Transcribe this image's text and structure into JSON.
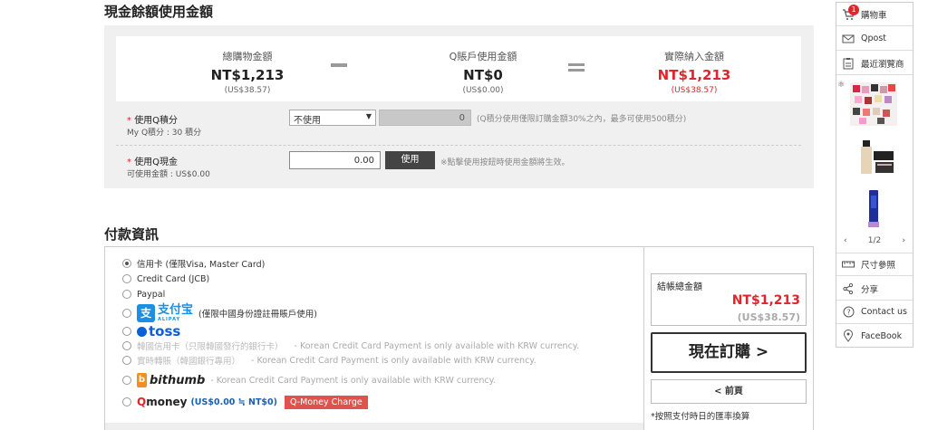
{
  "cash_section": {
    "title": "現金餘額使用金額",
    "total_label": "總購物金額",
    "total_value": "NT$1,213",
    "total_usd": "(US$38.57)",
    "q_label": "Q賬戶使用金額",
    "q_value": "NT$0",
    "q_usd": "(US$0.00)",
    "actual_label": "實際納入金額",
    "actual_value": "NT$1,213",
    "actual_usd": "(US$38.57)",
    "qpoint_label": "使用Q積分",
    "qpoint_sub": "My Q積分 : 30 積分",
    "qpoint_select": "不使用",
    "qpoint_input": "0",
    "qpoint_note": "(Q積分使用僅限訂購金額30%之內，最多可使用500積分)",
    "qcash_label": "使用Q現金",
    "qcash_sub": "可使用金額 : US$0.00",
    "qcash_input": "0.00",
    "qcash_button": "使用",
    "qcash_note": "※點擊使用按鈕時使用金額將生效。",
    "required_mark": "*"
  },
  "payment": {
    "title": "付款資訊",
    "options": [
      {
        "label": "信用卡 (僅限Visa, Master Card)",
        "selected": true
      },
      {
        "label": "Credit Card (JCB)"
      },
      {
        "label": "Paypal"
      },
      {
        "label": "(僅限中國身份證註冊賬戶使用)",
        "logo_text": "支付宝",
        "logo_sub": "ALIPAY",
        "logo_glyph": "支"
      },
      {
        "logo_text": "toss"
      },
      {
        "label": "韓國信用卡（只限韓國發行的銀行卡）",
        "note": "- Korean Credit Card Payment is only available with KRW currency."
      },
      {
        "label": "實時轉賬（韓國銀行專用）",
        "note": "- Korean Credit Card Payment is only available with KRW currency."
      },
      {
        "logo_text": "bithumb",
        "logo_glyph": "b",
        "note": "- Korean Credit Card Payment is only available with KRW currency."
      },
      {
        "logo_q": "Q",
        "logo_rest": "money",
        "value": "(US$0.00 ≒ NT$0)",
        "button": "Q-Money Charge"
      }
    ],
    "total_label": "結帳總金額",
    "total_value": "NT$1,213",
    "total_usd": "(US$38.57)",
    "buy_button": "現在訂購 >",
    "back_button": "< 前頁",
    "rate_note": "*按照支付時日的匯率換算"
  },
  "sidebar": {
    "cart_label": "購物車",
    "cart_count": "1",
    "qpost_label": "Qpost",
    "recent_label": "最近瀏覽商",
    "pager": "1/2",
    "prev": "‹",
    "next": "›",
    "size_label": "尺寸參照",
    "share_label": "分享",
    "contact_label": "Contact us",
    "facebook_label": "FaceBook"
  },
  "colors": {
    "accent_red": "#e0252b",
    "button_dark": "#444444",
    "toss_blue": "#0b5fd8",
    "alipay_blue": "#1a8fe3"
  }
}
